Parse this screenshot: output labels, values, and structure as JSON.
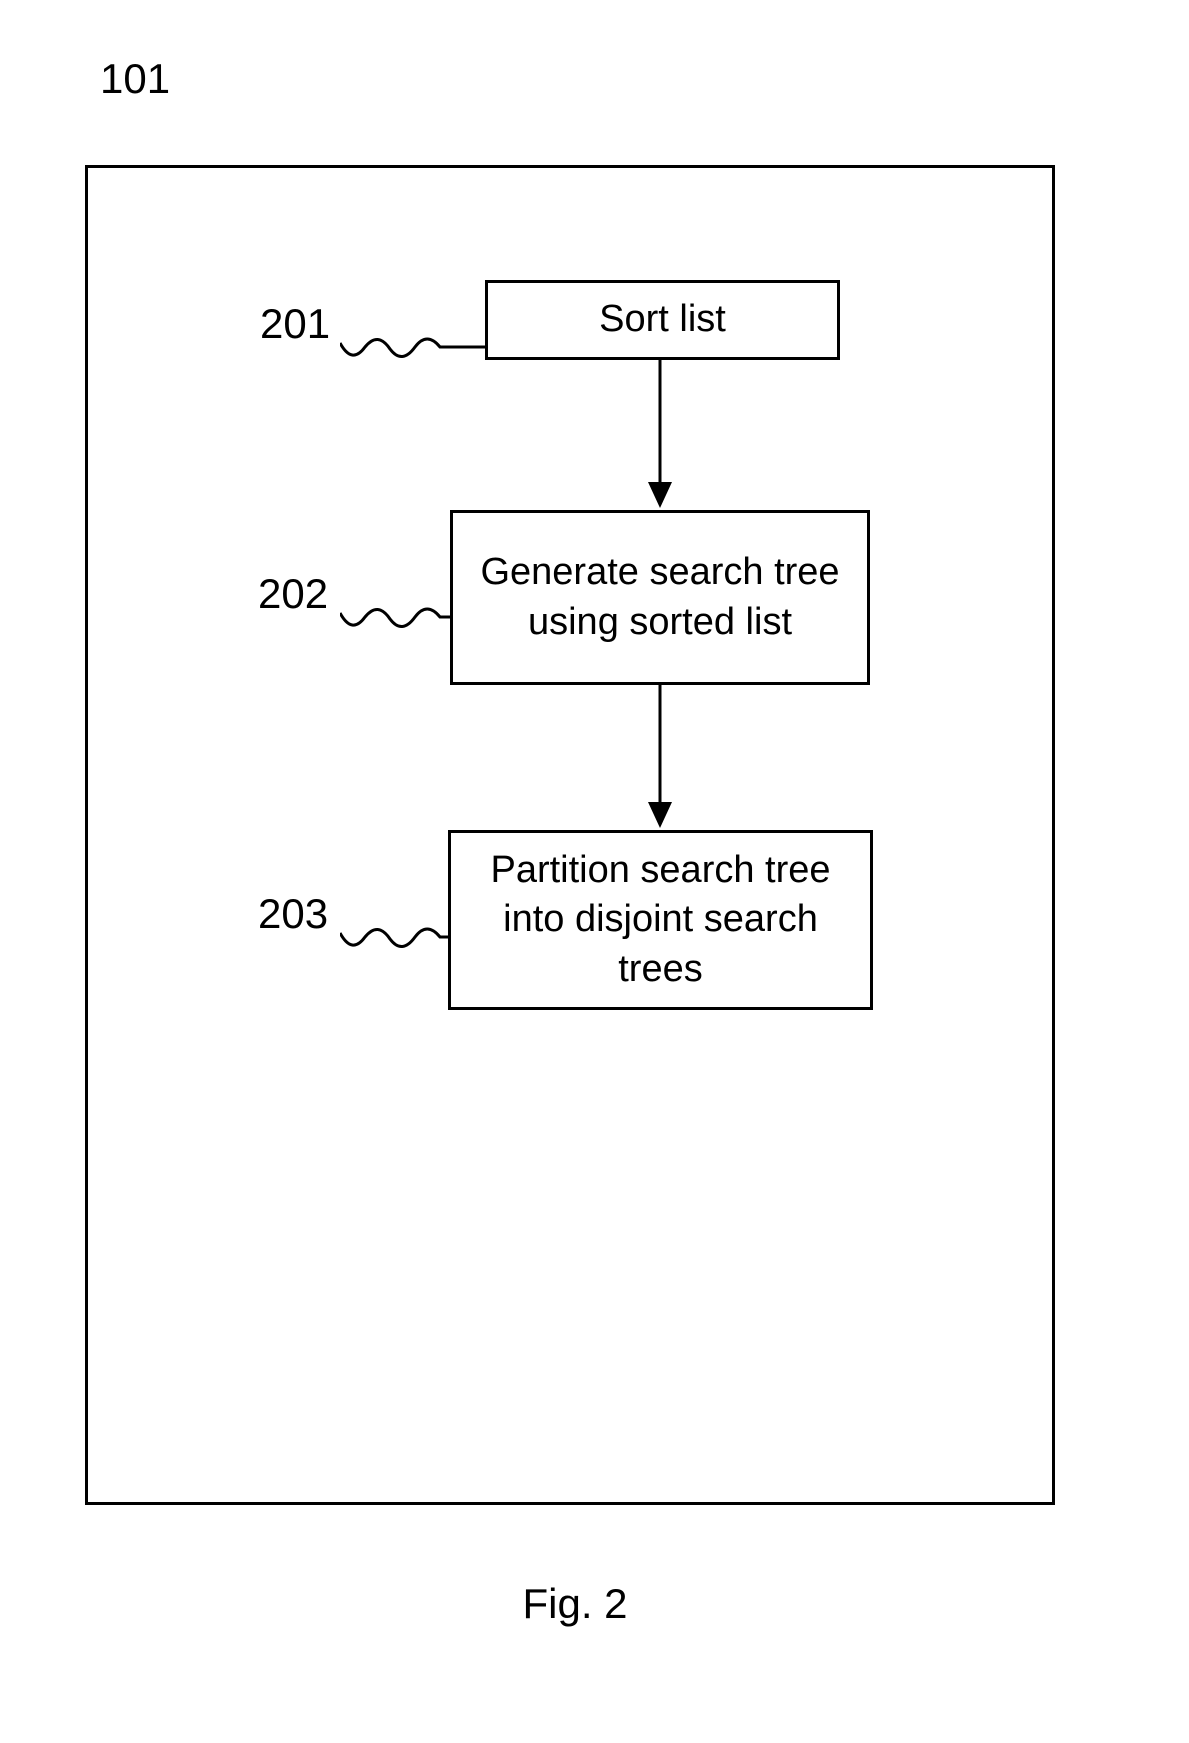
{
  "diagram": {
    "outer_label": "101",
    "figure_caption": "Fig. 2",
    "steps": [
      {
        "ref": "201",
        "text": "Sort list"
      },
      {
        "ref": "202",
        "text": "Generate search tree using sorted list"
      },
      {
        "ref": "203",
        "text": "Partition search tree into disjoint search trees"
      }
    ]
  }
}
